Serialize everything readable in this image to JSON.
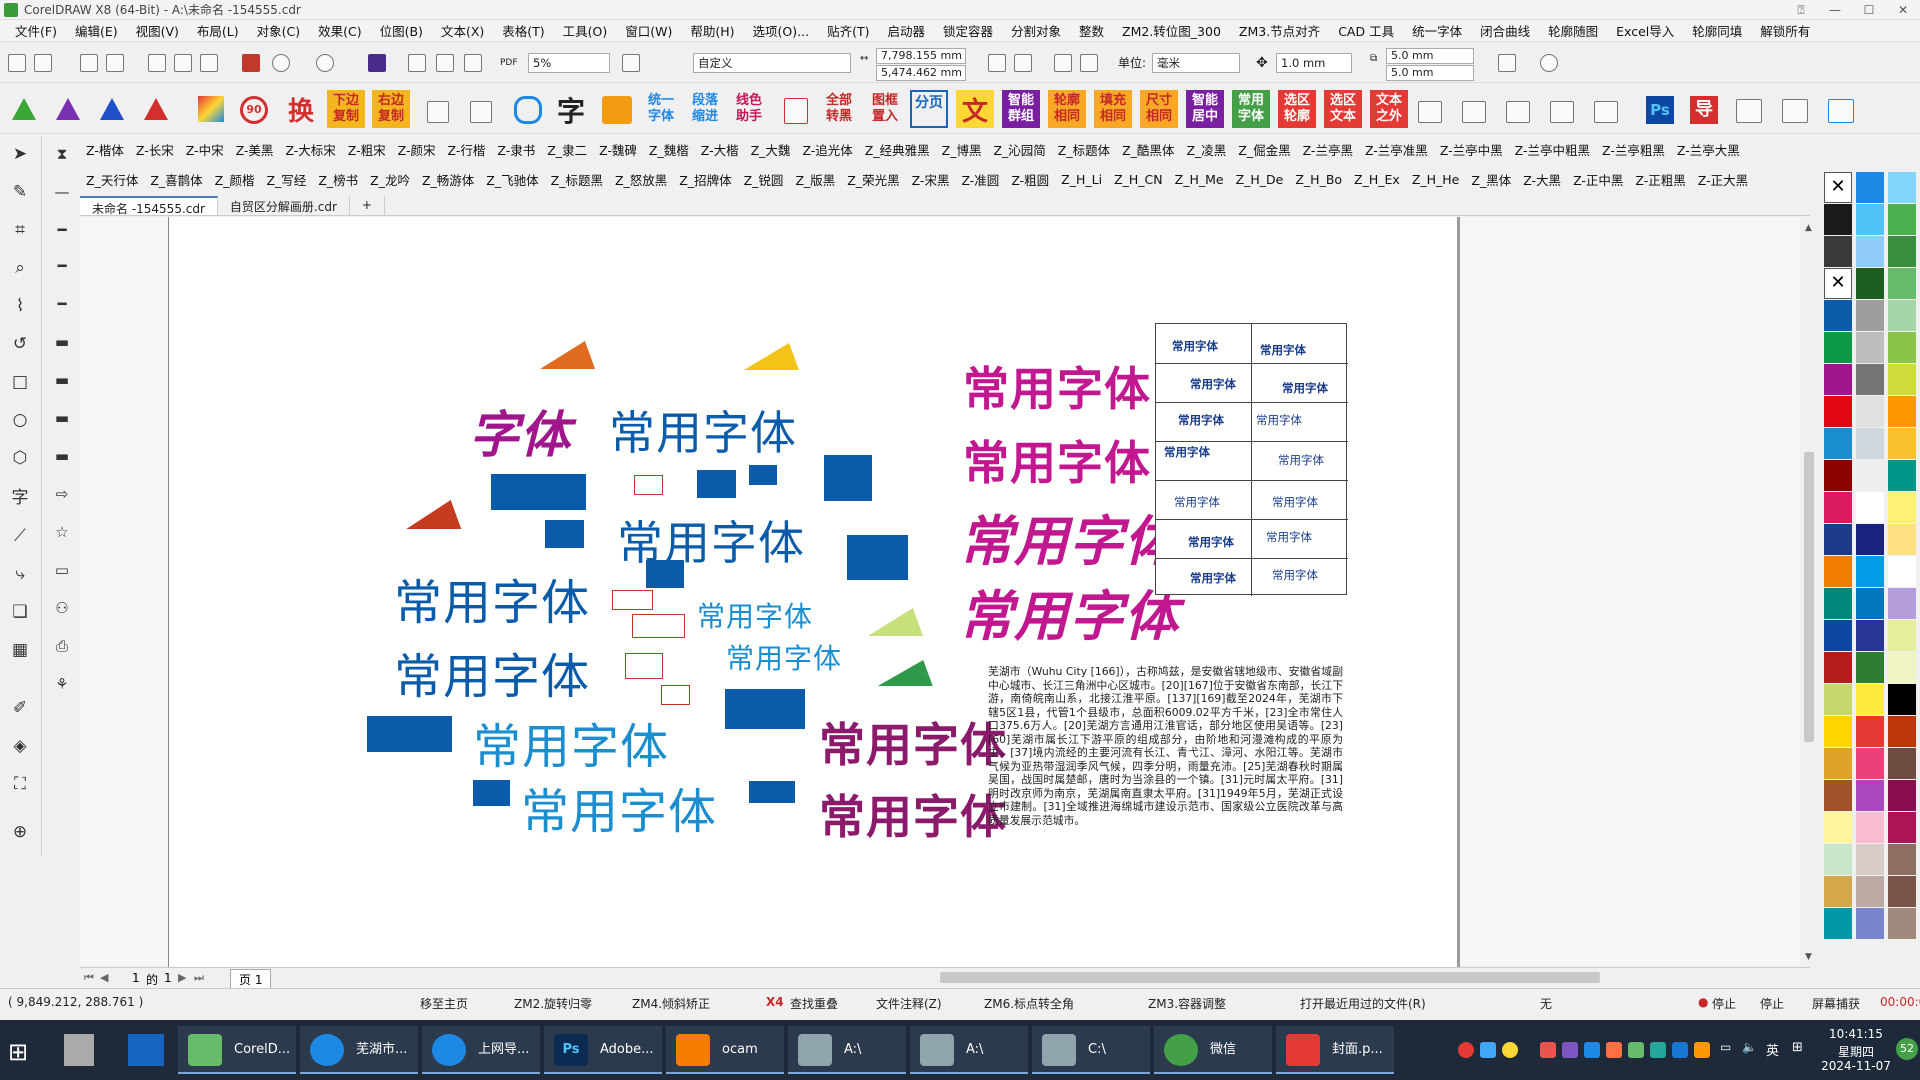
{
  "window": {
    "title": "CorelDRAW X8 (64-Bit) - A:\\未命名 -154555.cdr"
  },
  "menu": [
    "文件(F)",
    "编辑(E)",
    "视图(V)",
    "布局(L)",
    "对象(C)",
    "效果(C)",
    "位图(B)",
    "文本(X)",
    "表格(T)",
    "工具(O)",
    "窗口(W)",
    "帮助(H)",
    "选项(O)...",
    "贴齐(T)",
    "启动器",
    "锁定容器",
    "分割对象",
    "整数",
    "ZM2.转位图_300",
    "ZM3.节点对齐",
    "CAD 工具",
    "统一字体",
    "闭合曲线",
    "轮廓随图",
    "Excel导入",
    "轮廓同填",
    "解锁所有"
  ],
  "toolbar": {
    "zoom": "5%",
    "page_preset": "自定义",
    "width": "7,798.155 mm",
    "height": "5,474.462 mm",
    "units_label": "单位:",
    "units": "毫米",
    "nudge": "1.0 mm",
    "dup_x": "5.0 mm",
    "dup_y": "5.0 mm"
  },
  "bigbar": [
    "换",
    "下边复制",
    "右边复制",
    "字",
    "统一字体",
    "段落缩进",
    "线色助手",
    "全部转黑",
    "图框置入",
    "分页",
    "文",
    "智能群组",
    "轮廓相同",
    "填充相同",
    "尺寸相同",
    "智能居中",
    "常用字体",
    "选区轮廓",
    "选区文本",
    "文本之外"
  ],
  "fonts_row1": [
    "Z-楷体",
    "Z-长宋",
    "Z-中宋",
    "Z-美黑",
    "Z-大标宋",
    "Z-粗宋",
    "Z-颜宋",
    "Z-行楷",
    "Z-隶书",
    "Z_隶二",
    "Z-魏碑",
    "Z_魏楷",
    "Z-大楷",
    "Z_大魏",
    "Z-追光体",
    "Z_经典雅黑",
    "Z_博黑",
    "Z_沁园简",
    "Z_标题体",
    "Z_酷黑体",
    "Z_凌黑",
    "Z_倔金黑",
    "Z-兰亭黑",
    "Z-兰亭准黑",
    "Z-兰亭中黑",
    "Z-兰亭中粗黑",
    "Z-兰亭粗黑",
    "Z-兰亭大黑"
  ],
  "fonts_row2": [
    "Z_天行体",
    "Z_喜鹊体",
    "Z_颜楷",
    "Z_写经",
    "Z_榜书",
    "Z_龙吟",
    "Z_畅游体",
    "Z_飞驰体",
    "Z_标题黑",
    "Z_怒放黑",
    "Z_招牌体",
    "Z_锐圆",
    "Z_版黑",
    "Z_荣光黑",
    "Z-宋黑",
    "Z-准圆",
    "Z-粗圆",
    "Z_H_Li",
    "Z_H_CN",
    "Z_H_Me",
    "Z_H_De",
    "Z_H_Bo",
    "Z_H_Ex",
    "Z_H_He",
    "Z_黑体",
    "Z-大黑",
    "Z-正中黑",
    "Z-正粗黑",
    "Z-正大黑"
  ],
  "doc_tabs": [
    "未命名 -154555.cdr",
    "自贸区分解画册.cdr"
  ],
  "canvas": {
    "texts": {
      "t1a": "字体",
      "t1b": "常用字体",
      "t2": "常用字体",
      "t3": "常用字体",
      "t4": "常用字体",
      "t5": "常用字体",
      "t6": "常用字体",
      "t7": "常用字体",
      "t8": "常用字体",
      "r1": "常用字体",
      "r2": "常用字体",
      "r3": "常用字体",
      "r4": "常用字体",
      "r5": "常用字体",
      "r6": "常用字体"
    },
    "table": [
      [
        "常用字体",
        "常用字体"
      ],
      [
        "常用字体",
        "常用字体"
      ],
      [
        "常用字体",
        "常用字体"
      ],
      [
        "常用字体",
        "常用字体"
      ],
      [
        "常用字体",
        "常用字体"
      ],
      [
        "常用字体",
        "常用字体"
      ],
      [
        "常用字体",
        "常用字体"
      ]
    ],
    "paragraph": "芜湖市（Wuhu City [166]），古称鸠兹，是安徽省辖地级市、安徽省域副中心城市、长江三角洲中心区城市。[20][167]位于安徽省东南部，长江下游，南倚皖南山系，北接江淮平原。[137][169]截至2024年，芜湖市下辖5区1县，代管1个县级市，总面积6009.02平方千米，[23]全市常住人口375.6万人。[20]芜湖方言通用江淮官话，部分地区使用吴语等。[23][60]芜湖市属长江下游平原的组成部分，由阶地和河漫滩构成的平原为主，[37]境内流经的主要河流有长江、青弋江、漳河、水阳江等。芜湖市气候为亚热带湿润季风气候，四季分明，雨量充沛。[25]芜湖春秋时期属吴国，战国时属楚邮，唐时为当涂县的一个镇。[31]元时属太平府。[31]明时改京师为南京，芜湖属南直隶太平府。[31]1949年5月，芜湖正式设立市建制。[31]全域推进海绵城市建设示范市、国家级公立医院改革与高质量发展示范城市。"
  },
  "page_nav": {
    "current": "1",
    "of": "的",
    "total": "1",
    "tab": "页 1"
  },
  "status": {
    "coords": "( 9,849.212, 288.761 )",
    "items": [
      "移至主页",
      "ZM2.旋转归零",
      "ZM4.倾斜矫正",
      "X4",
      "查找重叠",
      "文件注释(Z)",
      "ZM6.标点转全角",
      "ZM3.容器调整",
      "打开最近用过的文件(R)",
      "无"
    ],
    "stop1": "停止",
    "stop2": "停止",
    "capture": "屏幕捕获",
    "timer": "00:00:00"
  },
  "taskbar": {
    "apps": [
      "CorelD...",
      "芜湖市...",
      "上网导...",
      "Adobe...",
      "ocam",
      "A:\\",
      "A:\\",
      "C:\\",
      "微信",
      "封面.p..."
    ],
    "ime": "英",
    "time": "10:41:15",
    "weekday": "星期四",
    "date": "2024-11-07",
    "badge": "52"
  },
  "colors": {
    "purple": "#a0158c",
    "blue": "#0a5cab",
    "lightblue": "#1b8ed0",
    "darkpurple": "#8b1a6b"
  }
}
